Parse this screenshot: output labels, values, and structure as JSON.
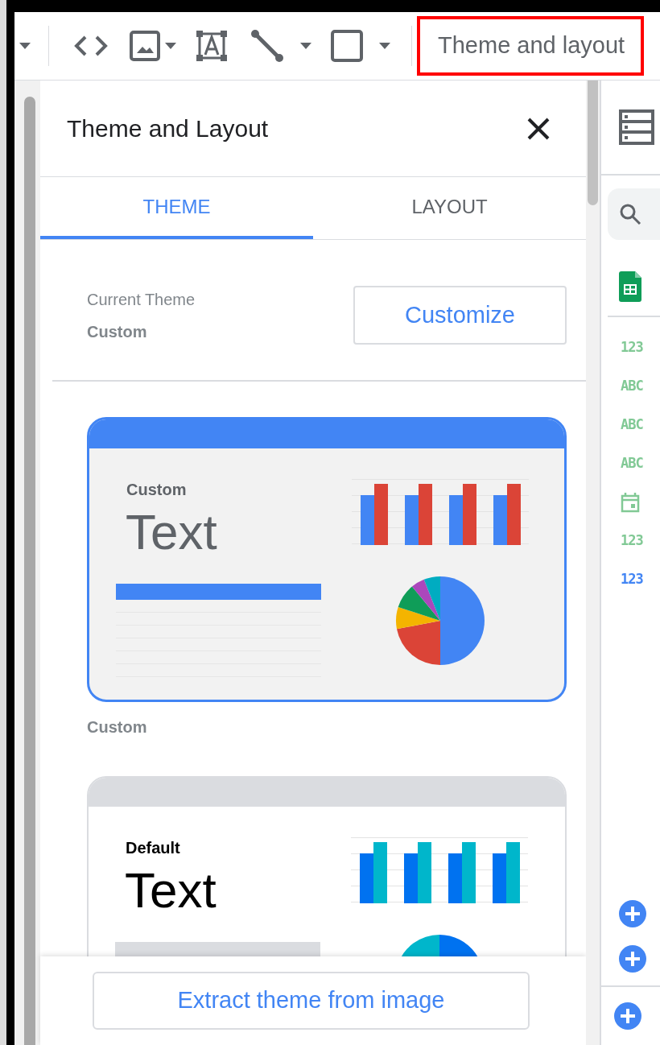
{
  "toolbar": {
    "theme_button": "Theme and layout"
  },
  "panel": {
    "title": "Theme and Layout",
    "tabs": [
      {
        "label": "THEME",
        "selected": true
      },
      {
        "label": "LAYOUT",
        "selected": false
      }
    ],
    "current_theme": {
      "label": "Current Theme",
      "value": "Custom"
    },
    "customize_button": "Customize",
    "themes": [
      {
        "kind": "custom",
        "name": "Custom",
        "sample_caption": "Custom",
        "sample_text": "Text",
        "selected": true
      },
      {
        "kind": "default",
        "sample_caption": "Default",
        "sample_text": "Text",
        "selected": false
      }
    ],
    "extract_button": "Extract theme from image"
  },
  "data_panel": {
    "fields": [
      {
        "kind": "number",
        "label": "123",
        "color": "#81c995"
      },
      {
        "kind": "text",
        "label": "ABC",
        "color": "#81c995"
      },
      {
        "kind": "text",
        "label": "ABC",
        "color": "#81c995"
      },
      {
        "kind": "text",
        "label": "ABC",
        "color": "#81c995"
      },
      {
        "kind": "date",
        "color": "#81c995"
      },
      {
        "kind": "number",
        "label": "123",
        "color": "#81c995"
      },
      {
        "kind": "number",
        "label": "123",
        "color": "#4285f4"
      }
    ]
  }
}
